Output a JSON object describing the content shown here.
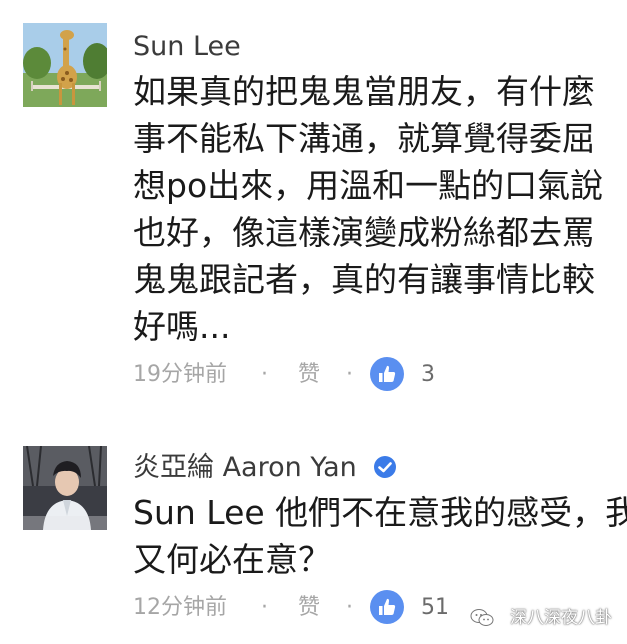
{
  "comments": [
    {
      "author": "Sun Lee",
      "body_lines": [
        "如果真的把鬼鬼當朋友，有什麼",
        "事不能私下溝通，就算覺得委屈",
        "想po出來，用溫和一點的口氣說",
        "也好，像這樣演變成粉絲都去罵",
        "鬼鬼跟記者，真的有讓事情比較",
        "好嗎..."
      ],
      "time": "19分钟前",
      "like_label": "赞",
      "like_count": "3",
      "avatar_icon": "giraffe-photo"
    },
    {
      "author": "炎亞綸 Aaron Yan",
      "verified_icon": "verified-check-icon",
      "mention": "Sun Lee",
      "body_line1_rest": " 他們不在意我的感受，我",
      "body_line2": "又何必在意？",
      "time": "12分钟前",
      "like_label": "赞",
      "like_count": "51",
      "avatar_icon": "person-photo"
    }
  ],
  "meta_separator": "·",
  "watermark": {
    "text": "深八深夜八卦",
    "icon": "wechat-logo-icon"
  },
  "colors": {
    "like_blue": "#5a8ff0",
    "verified_blue": "#3b7be8",
    "meta_gray": "#a6a6a6",
    "text": "#1a1a1a"
  }
}
